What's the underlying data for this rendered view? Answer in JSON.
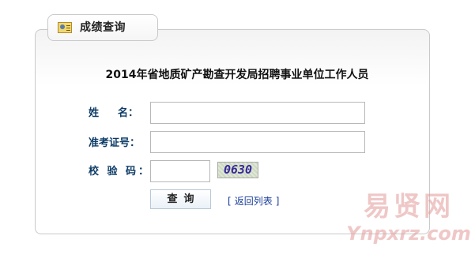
{
  "tab": {
    "icon": "id-card-icon",
    "title": "成绩查询"
  },
  "form": {
    "title": "2014年省地质矿产勘查开发局招聘事业单位工作人员",
    "name_label_1": "姓",
    "name_label_2": "名：",
    "ticket_label": "准考证号：",
    "code_label": "校 验 码：",
    "name_value": "",
    "ticket_value": "",
    "code_value": "",
    "captcha_text": "0630",
    "query_label": "查询",
    "back_open": "[",
    "back_label": "返回列表",
    "back_close": "]"
  },
  "watermark": {
    "cn": "易贤网",
    "en": "Ynpxrz.com"
  },
  "colors": {
    "label": "#0d3b66",
    "link": "#1a3d9a",
    "border": "#c9c9c9"
  }
}
